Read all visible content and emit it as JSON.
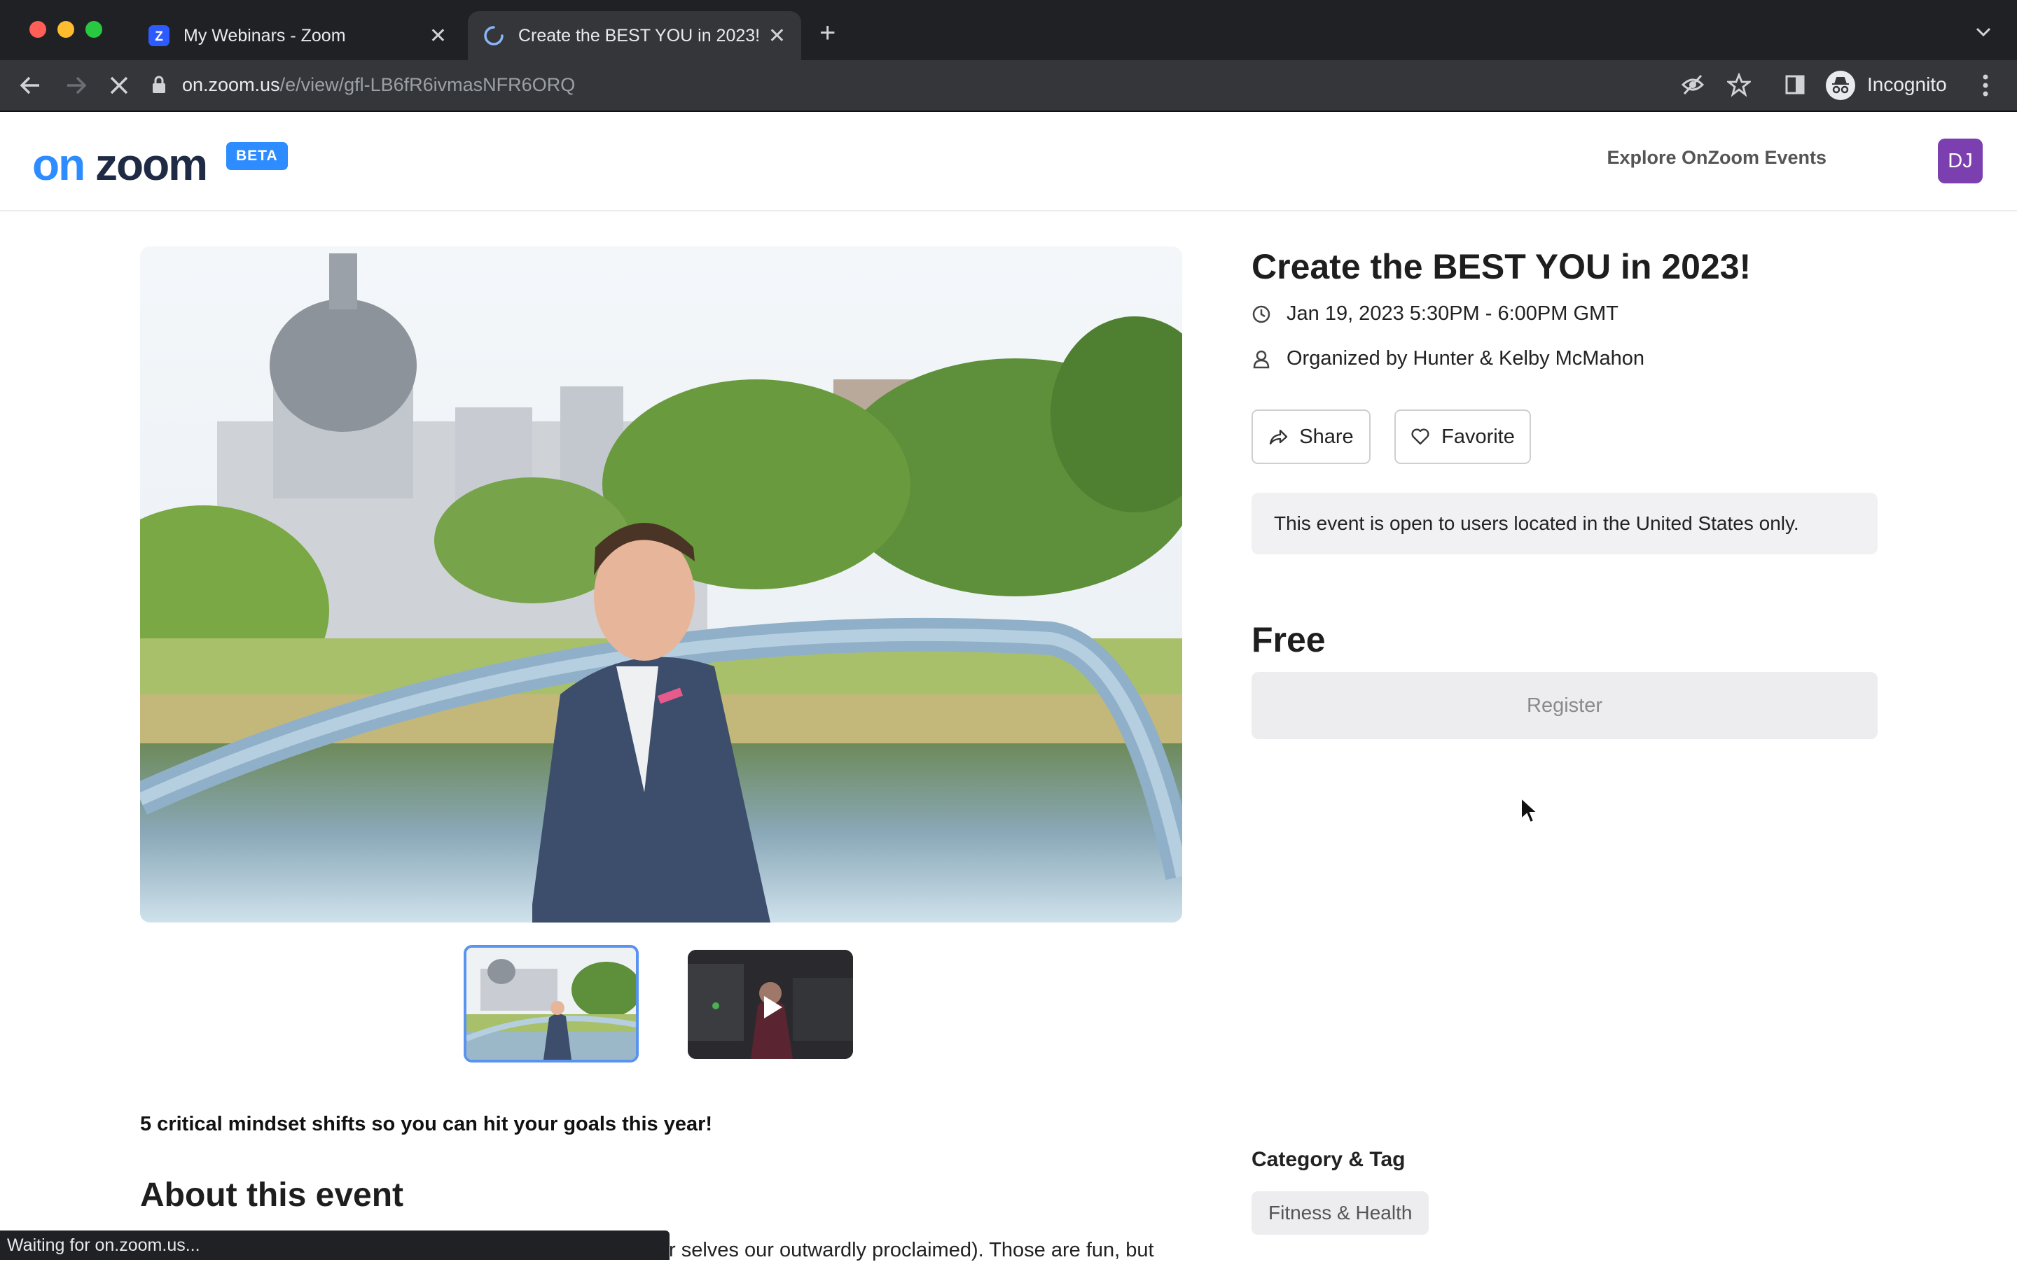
{
  "browser": {
    "tabs": [
      {
        "title": "My Webinars - Zoom",
        "favicon": "zoom-icon",
        "active": false
      },
      {
        "title": "Create the BEST YOU in 2023!",
        "favicon": "loading-spinner-icon",
        "active": true
      }
    ],
    "new_tab_label": "+",
    "address": {
      "host": "on.zoom.us",
      "path": "/e/view/gfl-LB6fR6ivmasNFR6ORQ"
    },
    "profile_label": "Incognito",
    "status_text": "Waiting for on.zoom.us..."
  },
  "site": {
    "logo_text": "on zoom",
    "beta_badge": "BETA",
    "nav_explore": "Explore OnZoom Events",
    "avatar_initials": "DJ",
    "brand_color": "#2d8cff"
  },
  "event": {
    "title": "Create the BEST YOU in 2023!",
    "datetime": "Jan 19, 2023 5:30PM - 6:00PM GMT",
    "organizer": "Organized by Hunter & Kelby McMahon",
    "share_label": "Share",
    "favorite_label": "Favorite",
    "notice": "This event is open to users located in the United States only.",
    "price": "Free",
    "register_label": "Register",
    "tagline": "5 critical mindset shifts so you can hit your goals this year!",
    "about_heading": "About this event",
    "description_fragment": "r selves our outwardly proclaimed).  Those are fun, but",
    "category_heading": "Category & Tag",
    "tags": [
      "Fitness & Health"
    ]
  }
}
